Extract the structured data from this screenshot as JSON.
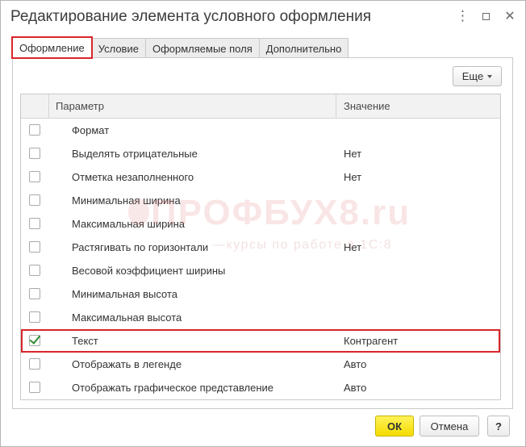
{
  "window": {
    "title": "Редактирование элемента условного оформления",
    "more_icon": "⋮",
    "maximize_icon": "square",
    "close_icon": "✕"
  },
  "tabs": [
    {
      "label": "Оформление",
      "active": true
    },
    {
      "label": "Условие",
      "active": false
    },
    {
      "label": "Оформляемые поля",
      "active": false
    },
    {
      "label": "Дополнительно",
      "active": false
    }
  ],
  "toolbar": {
    "more_label": "Еще"
  },
  "table": {
    "headers": {
      "param": "Параметр",
      "value": "Значение"
    },
    "rows": [
      {
        "param": "Формат",
        "value": "",
        "checked": false
      },
      {
        "param": "Выделять отрицательные",
        "value": "Нет",
        "checked": false
      },
      {
        "param": "Отметка незаполненного",
        "value": "Нет",
        "checked": false
      },
      {
        "param": "Минимальная ширина",
        "value": "",
        "checked": false
      },
      {
        "param": "Максимальная ширина",
        "value": "",
        "checked": false
      },
      {
        "param": "Растягивать по горизонтали",
        "value": "Нет",
        "checked": false
      },
      {
        "param": "Весовой коэффициент ширины",
        "value": "",
        "checked": false
      },
      {
        "param": "Минимальная высота",
        "value": "",
        "checked": false
      },
      {
        "param": "Максимальная высота",
        "value": "",
        "checked": false
      },
      {
        "param": "Текст",
        "value": "Контрагент",
        "checked": true,
        "highlighted": true
      },
      {
        "param": "Отображать в легенде",
        "value": "Авто",
        "checked": false
      },
      {
        "param": "Отображать графическое представление",
        "value": "Авто",
        "checked": false
      }
    ]
  },
  "watermark": {
    "main": "ПРОФБУХ8.ru",
    "sub": "—курсы по работе в 1С:8"
  },
  "footer": {
    "ok_label": "ОК",
    "cancel_label": "Отмена",
    "help_label": "?"
  },
  "colors": {
    "accent_red": "#d8252b",
    "ok_yellow": "#f4dc00",
    "check_green": "#2e8b2e"
  }
}
